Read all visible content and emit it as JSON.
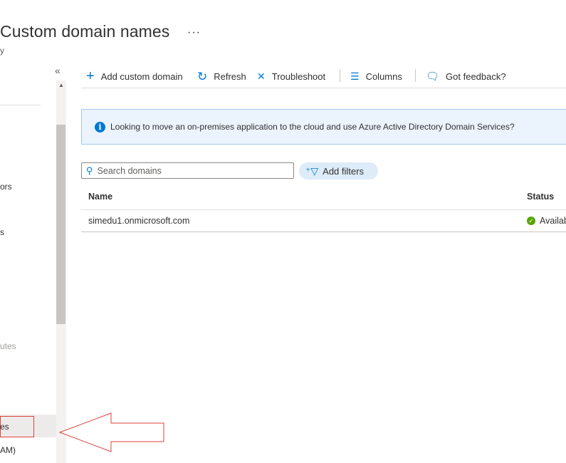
{
  "header": {
    "title": "Custom domain names",
    "more": "···",
    "subtitle": "y"
  },
  "sidebar": {
    "collapse": "«",
    "scroll_up": "▲",
    "items": [
      {
        "label": "ors"
      },
      {
        "label": "s"
      },
      {
        "label": "utes"
      },
      {
        "label": "es"
      },
      {
        "label": "AM)"
      }
    ]
  },
  "toolbar": {
    "add": {
      "icon": "+",
      "label": "Add custom domain"
    },
    "refresh": {
      "icon": "↻",
      "label": "Refresh"
    },
    "troubleshoot": {
      "icon": "✕",
      "label": "Troubleshoot"
    },
    "columns": {
      "icon": "☰",
      "label": "Columns"
    },
    "feedback": {
      "icon": "🗨",
      "label": "Got feedback?"
    }
  },
  "banner": {
    "icon": "i",
    "text": "Looking to move an on-premises application to the cloud and use Azure Active Directory Domain Services?"
  },
  "search": {
    "placeholder": "Search domains",
    "value": ""
  },
  "filters": {
    "label": "Add filters"
  },
  "table": {
    "columns": [
      "Name",
      "Status"
    ],
    "rows": [
      {
        "name": "simedu1.onmicrosoft.com",
        "status": "Available"
      }
    ]
  },
  "colors": {
    "accent": "#0078d4",
    "status_ok": "#57a300",
    "highlight": "#e04040"
  }
}
